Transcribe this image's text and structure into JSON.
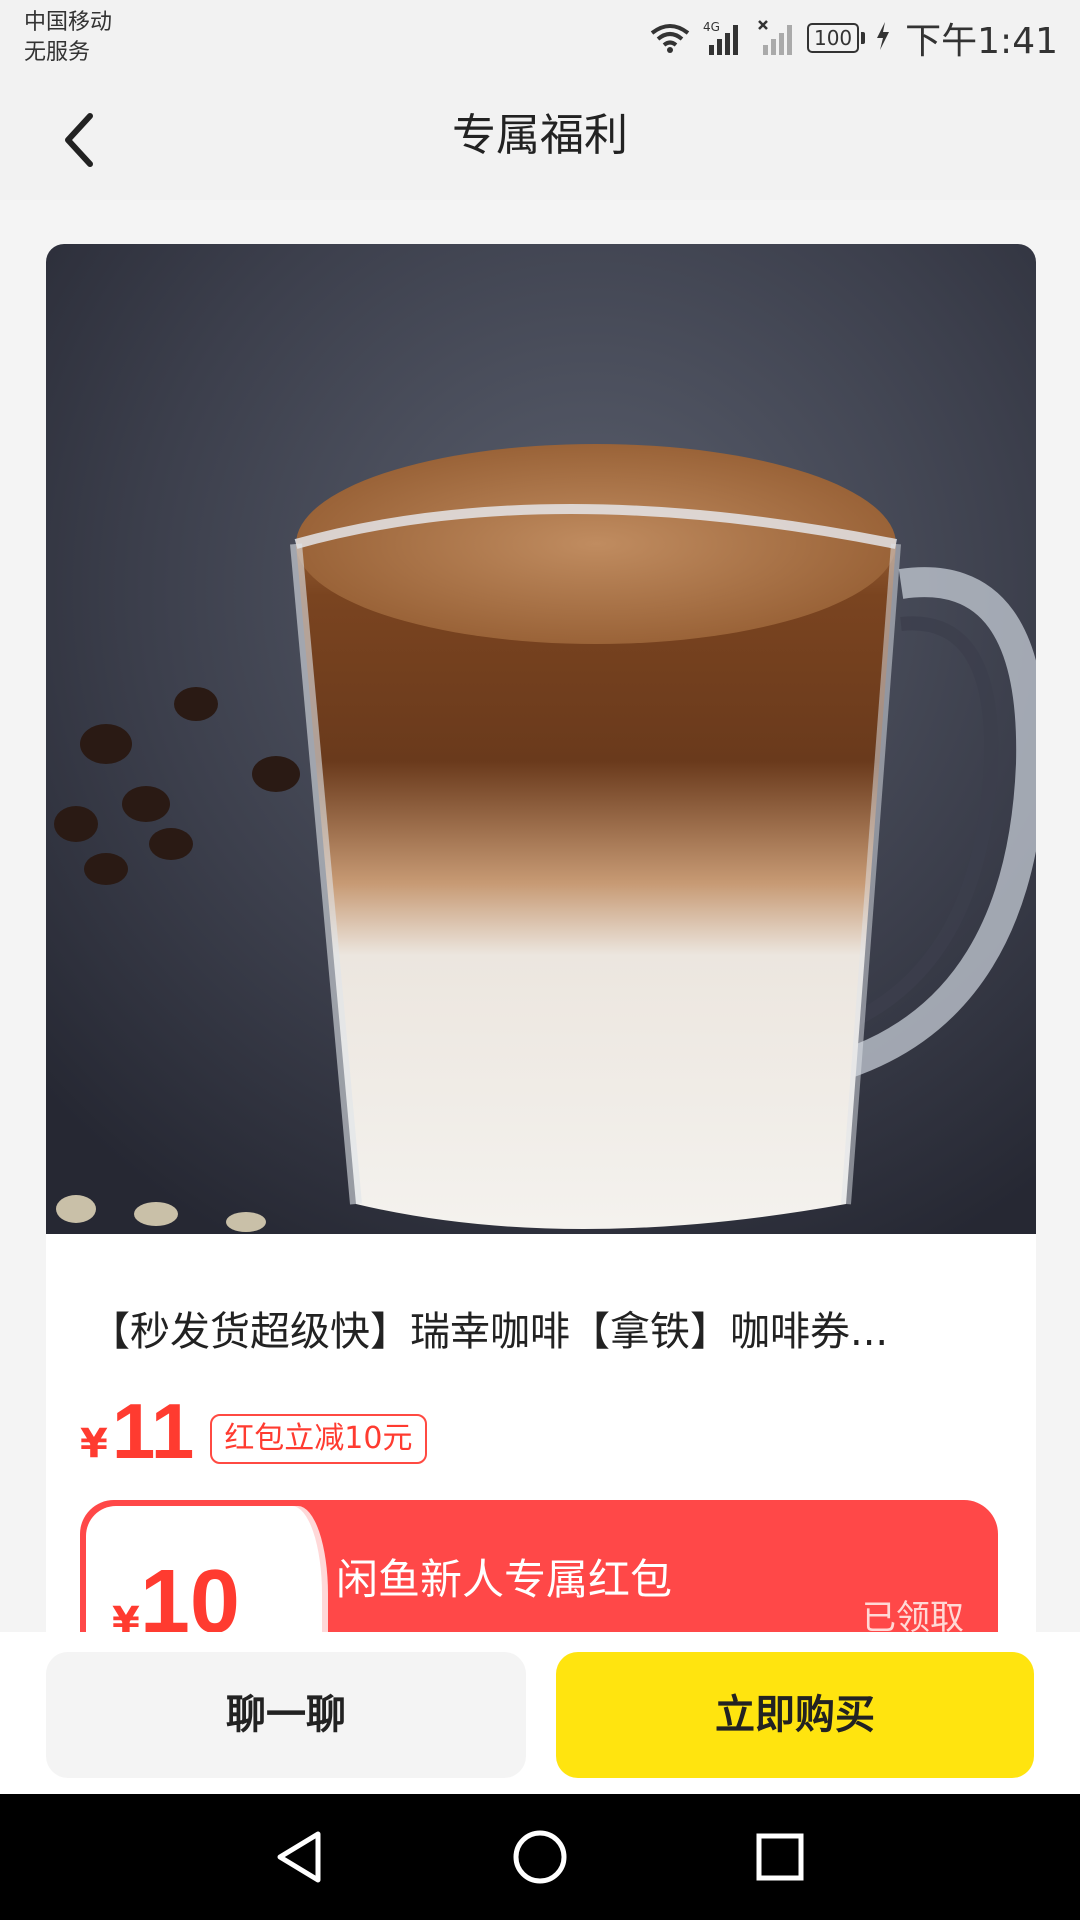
{
  "status_bar": {
    "carrier_line1": "中国移动",
    "carrier_line2": "无服务",
    "network": "4G",
    "battery": "100",
    "time": "下午1:41"
  },
  "header": {
    "title": "专属福利",
    "back_icon": "chevron-left-icon"
  },
  "product": {
    "image_icon": "coffee-latte-photo",
    "title": "【秒发货超级快】瑞幸咖啡【拿铁】咖啡券...",
    "price_currency": "¥",
    "price": "11",
    "discount_badge": "红包立减10元"
  },
  "coupon": {
    "currency": "¥",
    "amount": "10",
    "title": "闲鱼新人专属红包",
    "status": "已领取"
  },
  "actions": {
    "chat_label": "聊一聊",
    "buy_label": "立即购买"
  },
  "nav_bar": {
    "back_icon": "nav-back-icon",
    "home_icon": "nav-home-icon",
    "recents_icon": "nav-recents-icon"
  },
  "colors": {
    "accent_red": "#ff3b30",
    "coupon_red": "#ff4848",
    "buy_yellow": "#ffe40f"
  }
}
